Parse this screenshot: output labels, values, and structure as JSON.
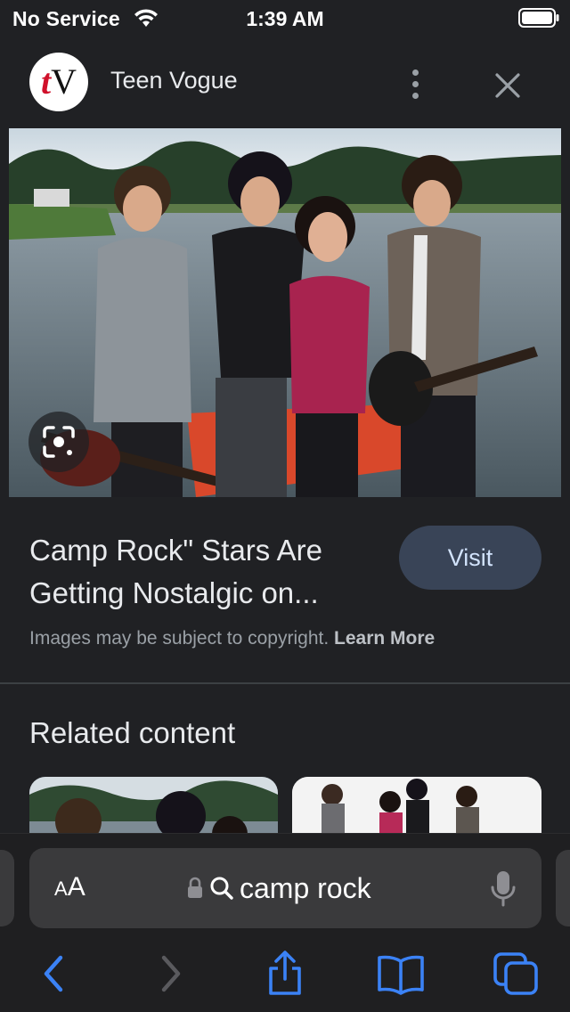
{
  "status_bar": {
    "carrier": "No Service",
    "time": "1:39 AM"
  },
  "header": {
    "logo_letters": {
      "t": "t",
      "v": "V"
    },
    "site_name": "Teen Vogue"
  },
  "result": {
    "title": "Camp Rock\" Stars Are Getting Nostalgic on...",
    "visit_label": "Visit",
    "copyright_text": "Images may be subject to copyright.",
    "learn_more_label": "Learn More"
  },
  "related": {
    "heading": "Related content"
  },
  "safari": {
    "reader_label_small": "A",
    "reader_label_large": "A",
    "url_text": "camp rock"
  },
  "colors": {
    "background": "#202124",
    "visit_button": "#394457",
    "safari_accent": "#3b82f6",
    "logo_red": "#d0112b"
  },
  "icons": {
    "status": [
      "wifi-icon",
      "battery-icon"
    ],
    "header": [
      "more-options-icon",
      "close-icon"
    ],
    "image": [
      "lens-search-icon"
    ],
    "address_bar": [
      "lock-icon",
      "search-icon",
      "microphone-icon"
    ],
    "toolbar": [
      "back-icon",
      "forward-icon",
      "share-icon",
      "bookmarks-icon",
      "tabs-icon"
    ]
  }
}
